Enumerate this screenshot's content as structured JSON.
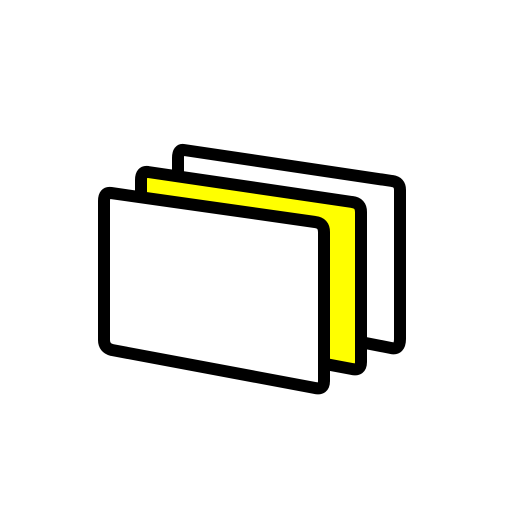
{
  "icon": {
    "name": "stacked-cards-icon",
    "layers": [
      {
        "name": "back-card",
        "fill": "#ffffff"
      },
      {
        "name": "middle-card",
        "fill": "#ffff00"
      },
      {
        "name": "front-card",
        "fill": "#ffffff"
      }
    ],
    "colors": {
      "outline": "#000000",
      "background": "#ffffff",
      "accent": "#ffff00"
    }
  }
}
